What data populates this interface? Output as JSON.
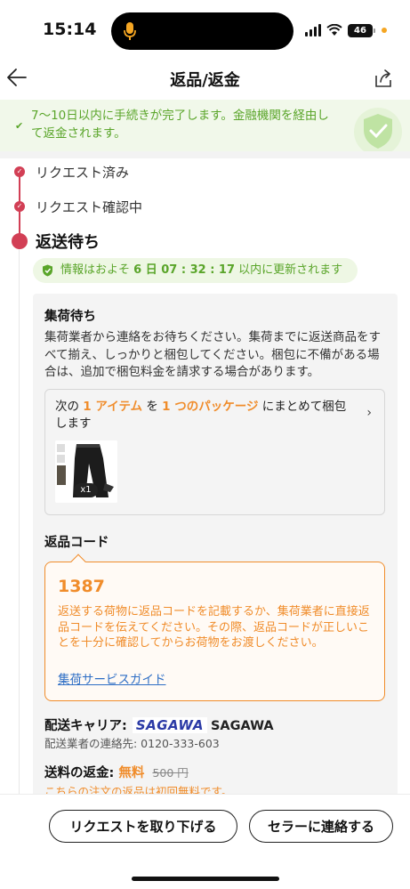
{
  "status_bar": {
    "time": "15:14",
    "battery": "46"
  },
  "nav": {
    "title": "返品/返金"
  },
  "banner": {
    "text": "7〜10日以内に手続きが完了します。金融機関を経由して返金されます。"
  },
  "timeline": {
    "steps": [
      {
        "label": "リクエスト済み",
        "state": "done"
      },
      {
        "label": "リクエスト確認中",
        "state": "done"
      },
      {
        "label": "返送待ち",
        "state": "current"
      }
    ],
    "update_notice": {
      "prefix": "情報はおよそ",
      "countdown": "6 日 07 : 32 : 17",
      "suffix": "以内に更新されます"
    }
  },
  "pickup": {
    "title": "集荷待ち",
    "description": "集荷業者から連絡をお待ちください。集荷までに返送商品をすべて揃え、しっかりと梱包してください。梱包に不備がある場合は、追加で梱包料金を請求する場合があります。",
    "package": {
      "text_1": "次の",
      "item_count": "1 アイテム",
      "text_2": "を",
      "package_count": "1 つのパッケージ",
      "text_3": "にまとめて梱包します",
      "quantity": "x1"
    }
  },
  "return_code": {
    "heading": "返品コード",
    "code": "1387",
    "description": "返送する荷物に返品コードを記載するか、集荷業者に直接返品コードを伝えてください。その際、返品コードが正しいことを十分に確認してからお荷物をお渡しください。",
    "guide_link": "集荷サービスガイド"
  },
  "carrier": {
    "label": "配送キャリア:",
    "logo_text": "SAGAWA",
    "name": "SAGAWA",
    "contact": "配送業者の連絡先: 0120-333-603"
  },
  "shipping_refund": {
    "label": "送料の返金:",
    "value": "無料",
    "original_price": "500 円",
    "note": "こちらの注文の返品は初回無料です。"
  },
  "actions": {
    "cancel_request": "リクエストを取り下げる",
    "contact_seller": "セラーに連絡する"
  },
  "colors": {
    "accent": "#d23f55",
    "success": "#5aa52a",
    "orange": "#f08c2a",
    "link": "#2e6ec5"
  }
}
